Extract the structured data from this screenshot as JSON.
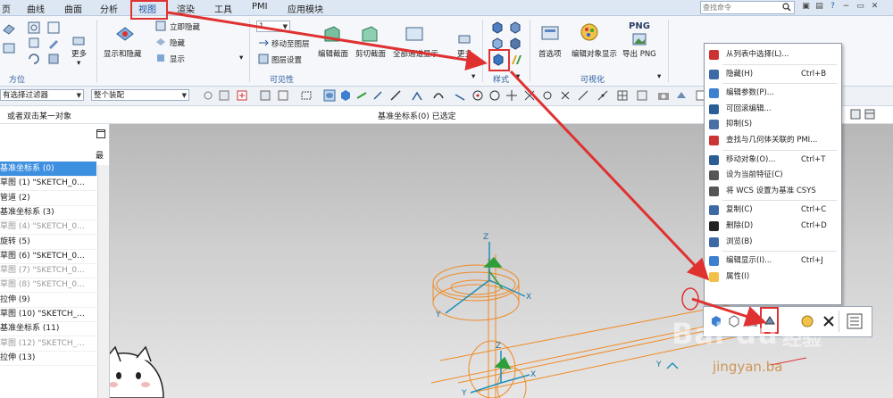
{
  "menubar": {
    "items": [
      "页",
      "曲线",
      "曲面",
      "分析",
      "视图",
      "渲染",
      "工具",
      "PMI",
      "应用模块"
    ],
    "active": "视图",
    "search_placeholder": "查找命令"
  },
  "ribbon": {
    "groups": {
      "orientation_label": "方位",
      "more_label": "更多",
      "visibility_label": "可见性",
      "style_label": "样式",
      "visualization_label": "可视化"
    },
    "buttons": {
      "show_hide": "显示和隐藏",
      "hide_immediately": "立即隐藏",
      "hide": "隐藏",
      "show": "显示",
      "layer_value": "1",
      "move_to_layer": "移动至图层",
      "layer_settings": "图层设置",
      "edit_section": "编辑截面",
      "clip_section": "剪切截面",
      "full_section_display": "全部通道显示",
      "more2": "更多",
      "preferences": "首选项",
      "edit_object_display": "编辑对象显示",
      "export_png_icon_text": "PNG",
      "export_png": "导出 PNG"
    }
  },
  "filterbar": {
    "selection_filter": "有选择过滤器",
    "assembly_scope": "整个装配"
  },
  "statusbar": {
    "prompt": "或者双击某一对象",
    "status": "基准坐标系(0) 已选定"
  },
  "navigator": {
    "column_header": "最",
    "rows": [
      {
        "label": "基准坐标系 (0)",
        "state": "selected"
      },
      {
        "label": "草图 (1) \"SKETCH_0...",
        "state": "normal"
      },
      {
        "label": "管道 (2)",
        "state": "normal"
      },
      {
        "label": "基准坐标系 (3)",
        "state": "normal"
      },
      {
        "label": "草图 (4) \"SKETCH_0...",
        "state": "dim"
      },
      {
        "label": "旋转 (5)",
        "state": "normal"
      },
      {
        "label": "草图 (6) \"SKETCH_0...",
        "state": "normal"
      },
      {
        "label": "草图 (7) \"SKETCH_0...",
        "state": "dim"
      },
      {
        "label": "草图 (8) \"SKETCH_0...",
        "state": "dim"
      },
      {
        "label": "拉伸 (9)",
        "state": "normal"
      },
      {
        "label": "草图 (10) \"SKETCH_...",
        "state": "normal"
      },
      {
        "label": "基准坐标系 (11)",
        "state": "normal"
      },
      {
        "label": "草图 (12) \"SKETCH_...",
        "state": "dim"
      },
      {
        "label": "拉伸 (13)",
        "state": "normal"
      }
    ]
  },
  "context_menu": {
    "items": [
      {
        "label": "从列表中选择(L)...",
        "shortcut": "",
        "icon": "select-from-list-icon",
        "sep_after": true
      },
      {
        "label": "隐藏(H)",
        "shortcut": "Ctrl+B",
        "icon": "hide-icon",
        "sep_after": true
      },
      {
        "label": "编辑参数(P)...",
        "shortcut": "",
        "icon": "edit-parameters-icon",
        "sep_after": false
      },
      {
        "label": "可回滚编辑...",
        "shortcut": "",
        "icon": "rollback-edit-icon",
        "sep_after": false
      },
      {
        "label": "抑制(S)",
        "shortcut": "",
        "icon": "suppress-icon",
        "sep_after": false
      },
      {
        "label": "查找与几何体关联的 PMI...",
        "shortcut": "",
        "icon": "find-pmi-icon",
        "sep_after": true
      },
      {
        "label": "移动对象(O)...",
        "shortcut": "Ctrl+T",
        "icon": "move-object-icon",
        "sep_after": false
      },
      {
        "label": "设为当前特征(C)",
        "shortcut": "",
        "icon": "make-current-icon",
        "sep_after": false
      },
      {
        "label": "将 WCS 设置为基准 CSYS",
        "shortcut": "",
        "icon": "wcs-icon",
        "sep_after": true
      },
      {
        "label": "复制(C)",
        "shortcut": "Ctrl+C",
        "icon": "copy-icon",
        "sep_after": false
      },
      {
        "label": "删除(D)",
        "shortcut": "Ctrl+D",
        "icon": "delete-icon",
        "sep_after": false
      },
      {
        "label": "浏览(B)",
        "shortcut": "",
        "icon": "browse-icon",
        "sep_after": true
      },
      {
        "label": "编辑显示(I)...",
        "shortcut": "Ctrl+J",
        "icon": "edit-display-icon",
        "sep_after": false
      },
      {
        "label": "属性(I)",
        "shortcut": "",
        "icon": "properties-icon",
        "sep_after": false
      }
    ]
  },
  "viewport": {
    "axis_labels": [
      "Z",
      "Y",
      "X",
      "Z",
      "Y",
      "X",
      "Y"
    ]
  },
  "watermark": {
    "brand": "Bai du",
    "sub": "经验",
    "url": "jingyan.ba"
  },
  "colors": {
    "annotation_red": "#e03131",
    "selection_blue": "#3d8fe0",
    "wireframe_orange": "#f08a24",
    "axis_blue": "#1f8fb8",
    "axis_green": "#2e9e3a"
  }
}
